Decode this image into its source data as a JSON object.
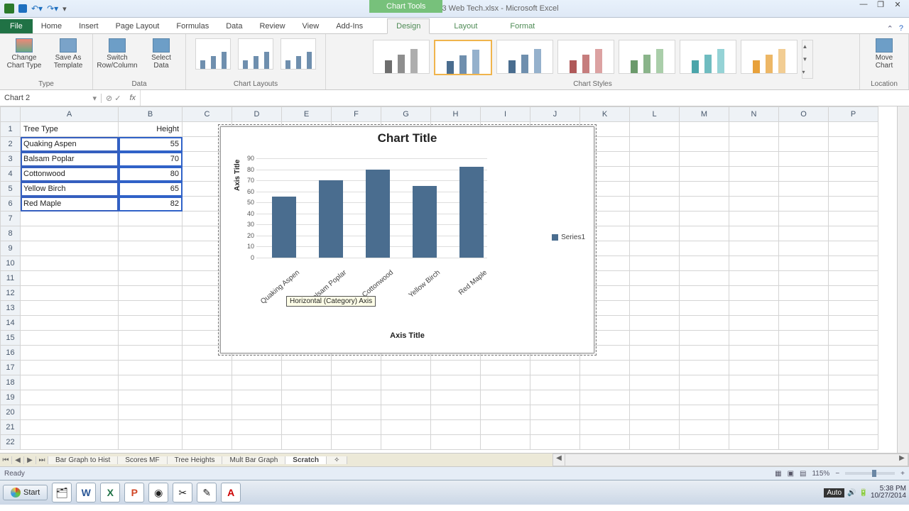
{
  "title": "Chap 3 Web Tech.xlsx - Microsoft Excel",
  "chart_tools_label": "Chart Tools",
  "tabs": {
    "file": "File",
    "home": "Home",
    "insert": "Insert",
    "page": "Page Layout",
    "formulas": "Formulas",
    "data": "Data",
    "review": "Review",
    "view": "View",
    "addins": "Add-Ins",
    "design": "Design",
    "layout": "Layout",
    "format": "Format"
  },
  "ribbon": {
    "type": {
      "label": "Type",
      "change": "Change\nChart Type",
      "save": "Save As\nTemplate"
    },
    "data": {
      "label": "Data",
      "switch": "Switch\nRow/Column",
      "select": "Select\nData"
    },
    "layouts": {
      "label": "Chart Layouts"
    },
    "styles": {
      "label": "Chart Styles"
    },
    "location": {
      "label": "Location",
      "move": "Move\nChart"
    }
  },
  "namebox": "Chart 2",
  "columns": [
    "",
    "A",
    "B",
    "C",
    "D",
    "E",
    "F",
    "G",
    "H",
    "I",
    "J",
    "K",
    "L",
    "M",
    "N",
    "O",
    "P"
  ],
  "rows": [
    1,
    2,
    3,
    4,
    5,
    6,
    7,
    8,
    9,
    10,
    11,
    12,
    13,
    14,
    15,
    16,
    17,
    18,
    19,
    20,
    21,
    22
  ],
  "cells": {
    "A1": "Tree Type",
    "B1": "Height",
    "A2": "Quaking Aspen",
    "B2": "55",
    "A3": "Balsam Poplar",
    "B3": "70",
    "A4": "Cottonwood",
    "B4": "80",
    "A5": "Yellow Birch",
    "B5": "65",
    "A6": "Red Maple",
    "B6": "82"
  },
  "chart_data": {
    "type": "bar",
    "title": "Chart Title",
    "xlabel": "Axis Title",
    "ylabel": "Axis Title",
    "categories": [
      "Quaking Aspen",
      "Balsam Poplar",
      "Cottonwood",
      "Yellow Birch",
      "Red Maple"
    ],
    "values": [
      55,
      70,
      80,
      65,
      82
    ],
    "series_name": "Series1",
    "ylim": [
      0,
      90
    ],
    "yticks": [
      0,
      10,
      20,
      30,
      40,
      50,
      60,
      70,
      80,
      90
    ]
  },
  "tooltip": "Horizontal (Category) Axis",
  "sheets": {
    "s1": "Bar Graph to Hist",
    "s2": "Scores MF",
    "s3": "Tree Heights",
    "s4": "Mult Bar Graph",
    "s5": "Scratch"
  },
  "status": {
    "ready": "Ready",
    "zoom": "115%",
    "auto": "Auto"
  },
  "taskbar": {
    "start": "Start",
    "time": "5:38 PM",
    "date": "10/27/2014"
  },
  "style_palette": [
    [
      "#6e6e6e",
      "#8e8e8e",
      "#aeaeae"
    ],
    [
      "#4a6d8f",
      "#6f8fae",
      "#95b1cc"
    ],
    [
      "#4a6d8f",
      "#6f8fae",
      "#95b1cc"
    ],
    [
      "#b05959",
      "#c67d7d",
      "#dca2a2"
    ],
    [
      "#6b9a6b",
      "#8ab48a",
      "#aaceaa"
    ],
    [
      "#4aa5aa",
      "#6fbcc0",
      "#95d3d6"
    ],
    [
      "#e8a13a",
      "#edb766",
      "#f2cd93"
    ]
  ]
}
